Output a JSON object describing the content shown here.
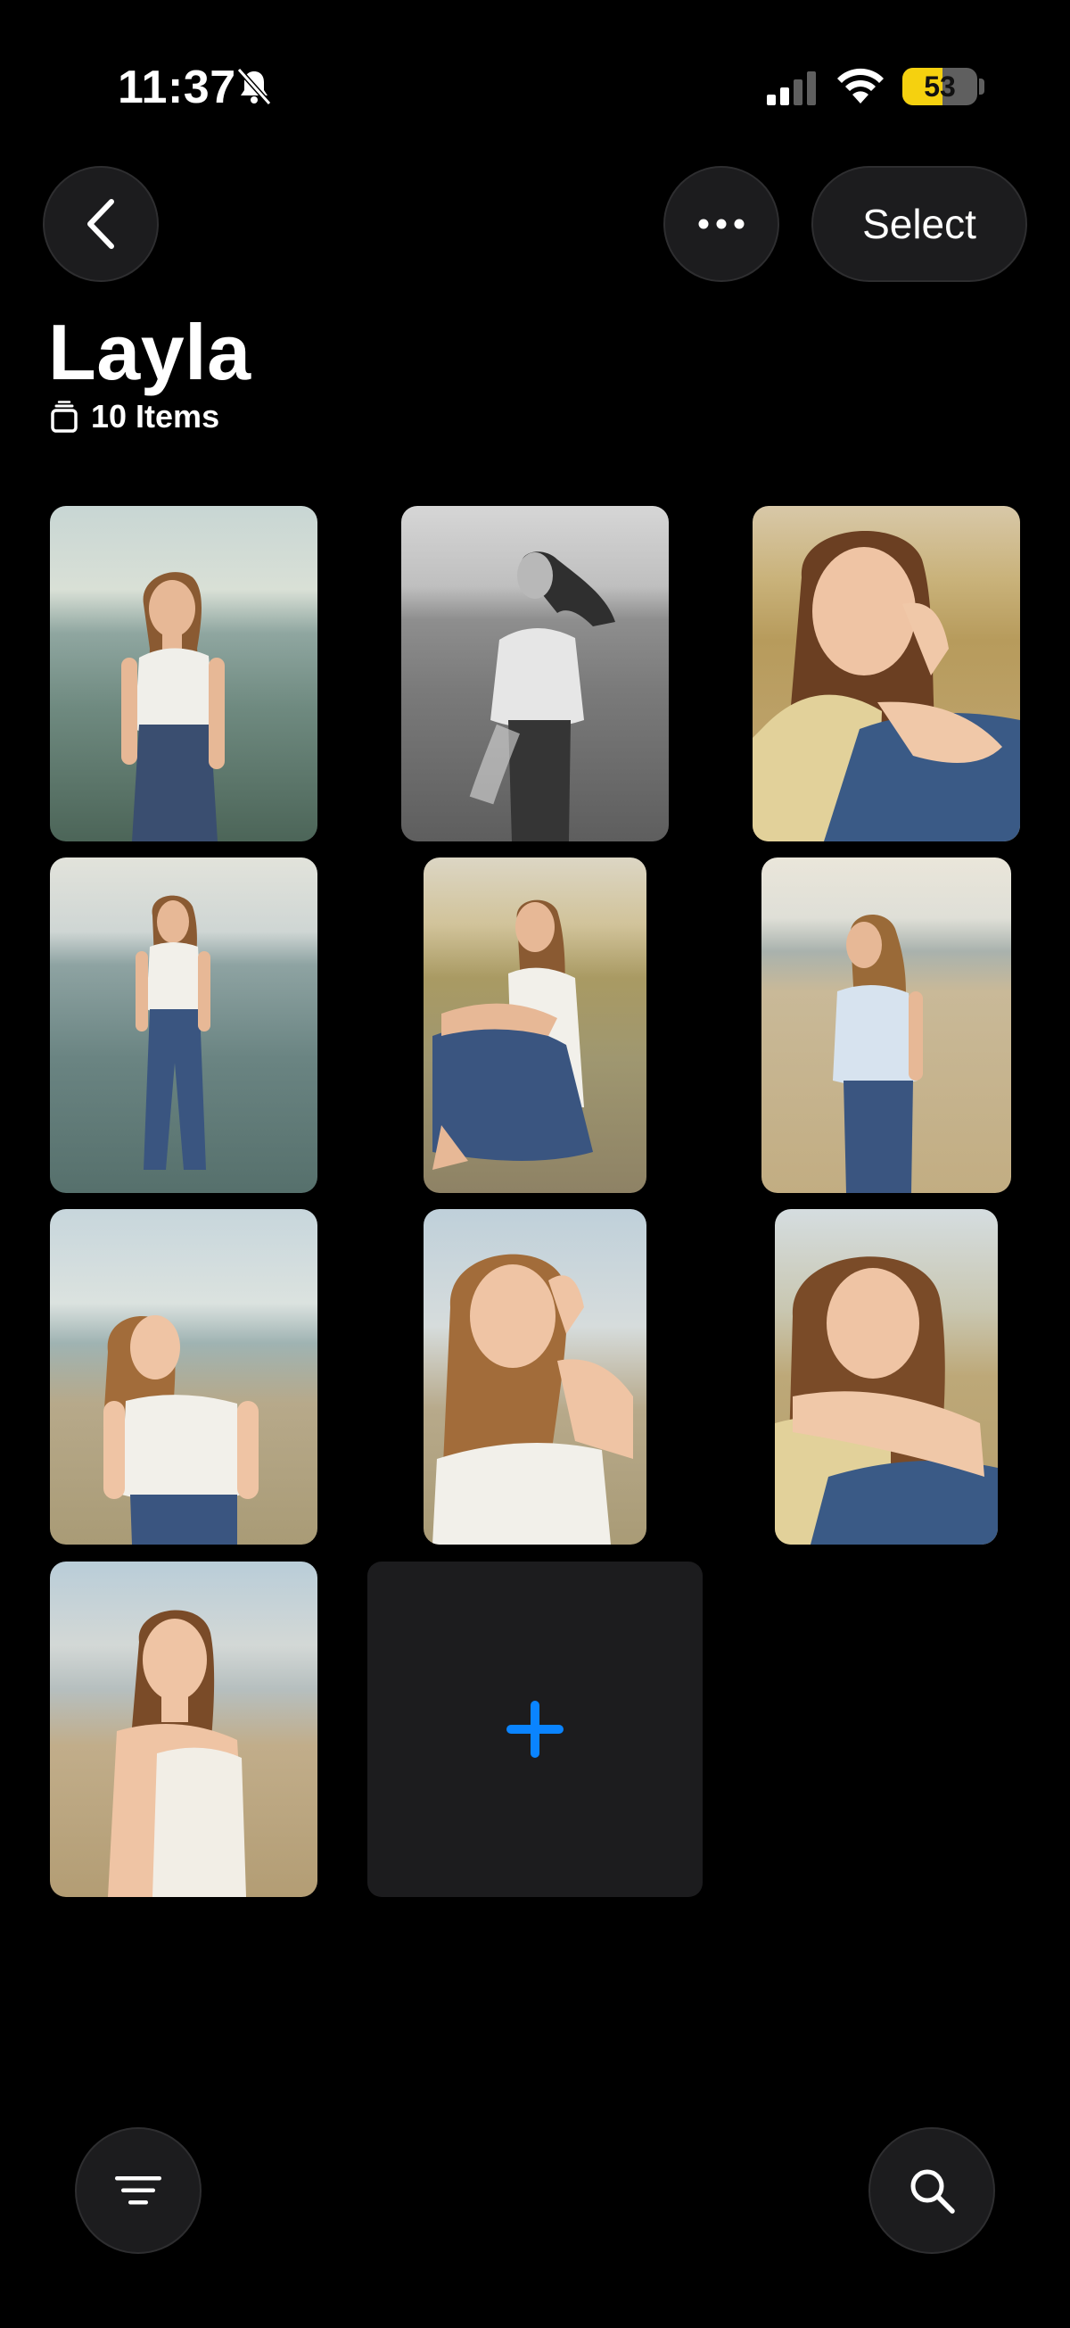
{
  "status_bar": {
    "time": "11:37",
    "battery": "53",
    "battery_level": 0.53,
    "battery_color": "#f5d10f"
  },
  "nav": {
    "back_icon": "chevron-left-icon",
    "more_icon": "ellipsis-icon",
    "select_label": "Select"
  },
  "album": {
    "title": "Layla",
    "count_label": "10 Items",
    "count_icon": "stack-icon"
  },
  "photos": [
    {
      "description_icon": "photo-thumbnail"
    },
    {
      "description_icon": "photo-thumbnail"
    },
    {
      "description_icon": "photo-thumbnail"
    },
    {
      "description_icon": "photo-thumbnail"
    },
    {
      "description_icon": "photo-thumbnail"
    },
    {
      "description_icon": "photo-thumbnail"
    },
    {
      "description_icon": "photo-thumbnail"
    },
    {
      "description_icon": "photo-thumbnail"
    },
    {
      "description_icon": "photo-thumbnail"
    },
    {
      "description_icon": "photo-thumbnail"
    }
  ],
  "add_tile": {
    "icon": "plus-icon",
    "color": "#0a84ff"
  },
  "bottom": {
    "filter_icon": "filter-icon",
    "search_icon": "search-icon"
  }
}
